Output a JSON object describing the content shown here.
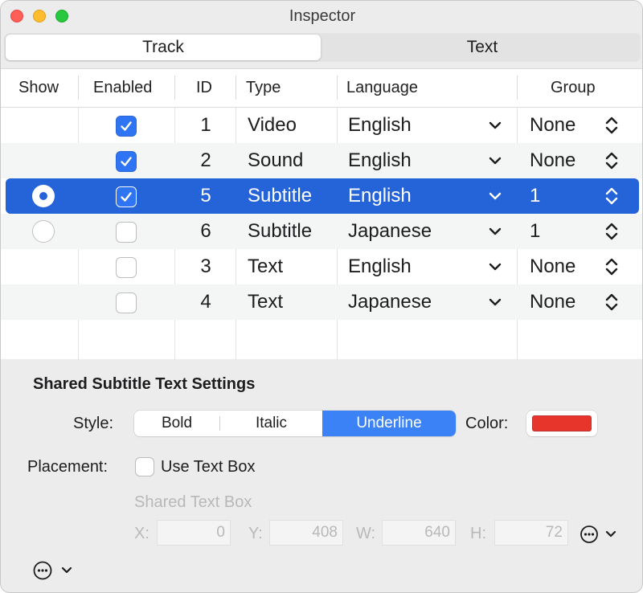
{
  "window": {
    "title": "Inspector"
  },
  "tabs": [
    "Track",
    "Text"
  ],
  "table": {
    "columns": [
      "Show",
      "Enabled",
      "ID",
      "Type",
      "Language",
      "Group"
    ],
    "rows": [
      {
        "show": "none",
        "enabled": true,
        "id": "1",
        "type": "Video",
        "language": "English",
        "group": "None",
        "selected": false
      },
      {
        "show": "none",
        "enabled": true,
        "id": "2",
        "type": "Sound",
        "language": "English",
        "group": "None",
        "selected": false
      },
      {
        "show": "on",
        "enabled": true,
        "id": "5",
        "type": "Subtitle",
        "language": "English",
        "group": "1",
        "selected": true
      },
      {
        "show": "off",
        "enabled": false,
        "id": "6",
        "type": "Subtitle",
        "language": "Japanese",
        "group": "1",
        "selected": false
      },
      {
        "show": "none",
        "enabled": false,
        "id": "3",
        "type": "Text",
        "language": "English",
        "group": "None",
        "selected": false
      },
      {
        "show": "none",
        "enabled": false,
        "id": "4",
        "type": "Text",
        "language": "Japanese",
        "group": "None",
        "selected": false
      }
    ]
  },
  "settings": {
    "heading": "Shared Subtitle Text Settings",
    "style_label": "Style:",
    "style_options": [
      "Bold",
      "Italic",
      "Underline"
    ],
    "style_selected": "Underline",
    "color_label": "Color:",
    "color_value": "#e8352b",
    "placement_label": "Placement:",
    "use_text_box_label": "Use Text Box",
    "use_text_box_checked": false,
    "text_box_title": "Shared Text Box",
    "fields": [
      {
        "label": "X:",
        "value": "0"
      },
      {
        "label": "Y:",
        "value": "408"
      },
      {
        "label": "W:",
        "value": "640"
      },
      {
        "label": "H:",
        "value": "72"
      }
    ]
  },
  "colors": {
    "selection": "#2563d9",
    "accent": "#3b82f7"
  }
}
